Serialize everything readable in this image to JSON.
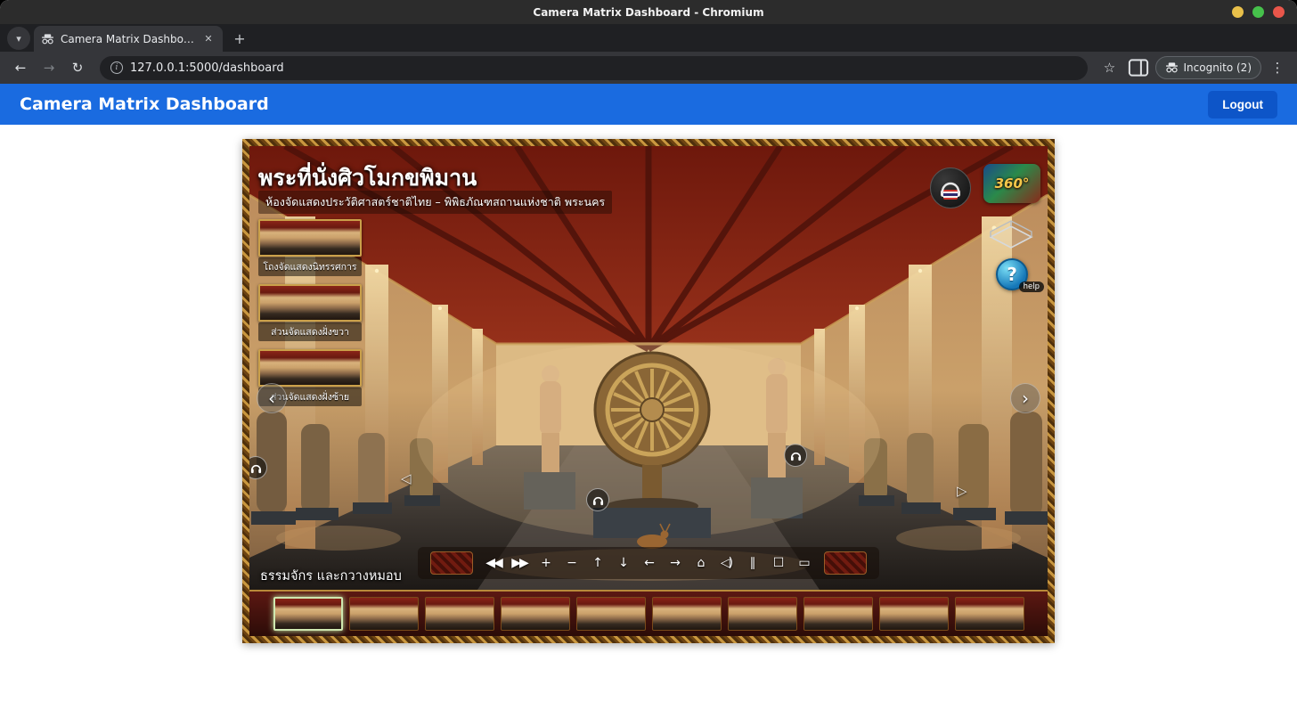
{
  "window": {
    "title": "Camera Matrix Dashboard - Chromium"
  },
  "browser": {
    "tab_title": "Camera Matrix Dashboard",
    "url": "127.0.0.1:5000/dashboard",
    "incognito_label": "Incognito (2)"
  },
  "header": {
    "title": "Camera Matrix Dashboard",
    "logout_label": "Logout"
  },
  "tour": {
    "title": "พระที่นั่งศิวโมกขพิมาน",
    "subtitle": "ห้องจัดแสดงประวัติศาสตร์ชาติไทย – พิพิธภัณฑสถานแห่งชาติ พระนคร",
    "caption": "ธรรมจักร และกวางหมอบ",
    "logo_360_label": "360°",
    "help_question": "?",
    "help_label": "help",
    "nav_left_glyph": "‹",
    "nav_right_glyph": "›",
    "floor_arrow_left": "◁",
    "floor_arrow_right": "▷",
    "menu": [
      {
        "label": "โถงจัดแสดงนิทรรศการ"
      },
      {
        "label": "ส่วนจัดแสดงฝั่งขวา"
      },
      {
        "label": "ส่วนจัดแสดงฝั่งซ้าย"
      }
    ],
    "controls": [
      {
        "name": "previous-scene",
        "glyph": "◀◀"
      },
      {
        "name": "next-scene",
        "glyph": "▶▶"
      },
      {
        "name": "zoom-in",
        "glyph": "+"
      },
      {
        "name": "zoom-out",
        "glyph": "−"
      },
      {
        "name": "pan-up",
        "glyph": "↑"
      },
      {
        "name": "pan-down",
        "glyph": "↓"
      },
      {
        "name": "pan-left",
        "glyph": "←"
      },
      {
        "name": "pan-right",
        "glyph": "→"
      },
      {
        "name": "home-view",
        "glyph": "⌂"
      },
      {
        "name": "volume",
        "glyph": "◁)"
      },
      {
        "name": "autorotate",
        "glyph": "∥"
      },
      {
        "name": "fullscreen",
        "glyph": "☐"
      },
      {
        "name": "hide-controls",
        "glyph": "▭"
      }
    ],
    "thumbnail_count": 10,
    "selected_thumbnail_index": 0
  },
  "colors": {
    "header_blue": "#1a6be0",
    "logout_blue": "#0d55c8",
    "frame_gold": "#c9973f",
    "strip_maroon": "#5c1812",
    "selected_thumb_green": "#cfe8b0"
  }
}
